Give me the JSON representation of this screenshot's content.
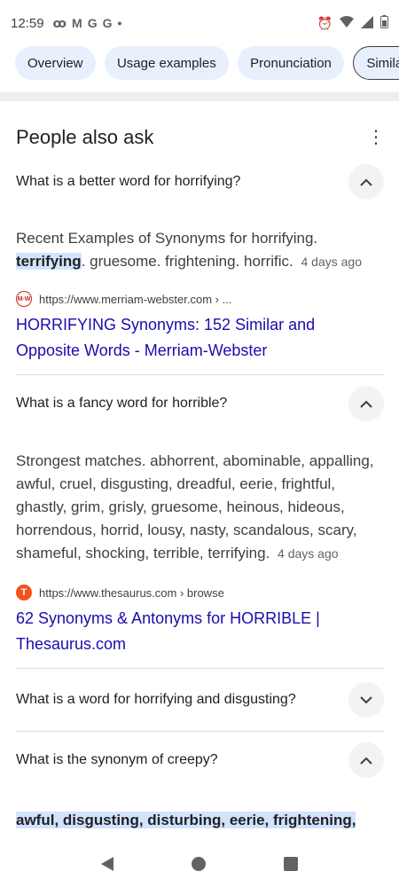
{
  "status_bar": {
    "time": "12:59",
    "left_icons": [
      "voicemail-icon",
      "gmail-icon",
      "google-icon",
      "google-icon",
      "dot-icon"
    ],
    "right_icons": [
      "alarm-icon",
      "wifi-icon",
      "signal-icon",
      "battery-icon"
    ]
  },
  "chips": [
    "Overview",
    "Usage examples",
    "Pronunciation",
    "Simila"
  ],
  "paa": {
    "title": "People also ask",
    "q1": {
      "question": "What is a better word for horrifying?",
      "answer_pre": "Recent Examples of Synonyms for horrifying.",
      "answer_highlight": "terrifying",
      "answer_post": ". gruesome. frightening. horrific.",
      "date": "4 days ago",
      "source_url": "https://www.merriam-webster.com › ...",
      "favicon_text": "M-W",
      "link_title": "HORRIFYING Synonyms: 152 Similar and Opposite Words - Merriam-Webster"
    },
    "q2": {
      "question": "What is a fancy word for horrible?",
      "answer": "Strongest matches. abhorrent, abominable, appalling, awful, cruel, disgusting, dreadful, eerie, frightful, ghastly, grim, grisly, gruesome, heinous, hideous, horrendous, horrid, lousy, nasty, scandalous, scary, shameful, shocking, terrible, terrifying.",
      "date": "4 days ago",
      "source_url": "https://www.thesaurus.com › browse",
      "favicon_text": "T",
      "link_title": "62 Synonyms & Antonyms for HORRIBLE | Thesaurus.com"
    },
    "q3": {
      "question": "What is a word for horrifying and disgusting?"
    },
    "q4": {
      "question": "What is the synonym of creepy?",
      "answer_highlight": "awful, disgusting, disturbing, eerie, frightening,"
    }
  }
}
